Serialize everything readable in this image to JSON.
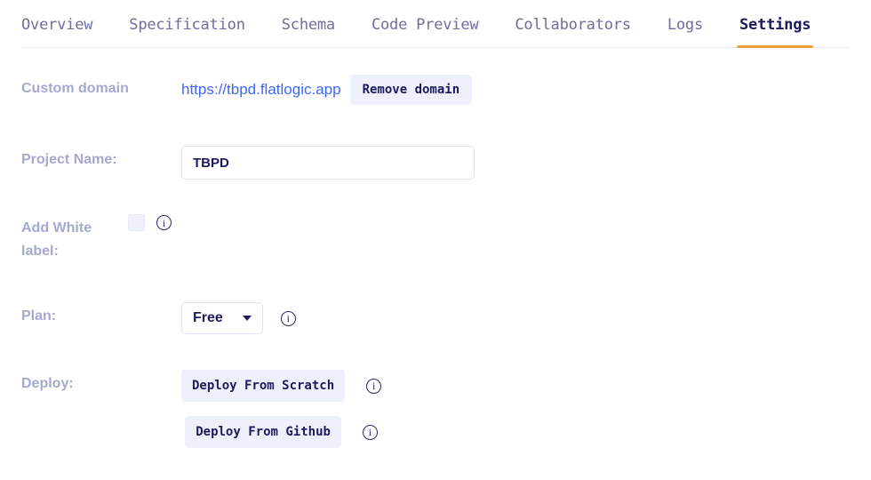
{
  "tabs": [
    {
      "label": "Overview",
      "active": false
    },
    {
      "label": "Specification",
      "active": false
    },
    {
      "label": "Schema",
      "active": false
    },
    {
      "label": "Code Preview",
      "active": false
    },
    {
      "label": "Collaborators",
      "active": false
    },
    {
      "label": "Logs",
      "active": false
    },
    {
      "label": "Settings",
      "active": true
    }
  ],
  "settings": {
    "custom_domain": {
      "label": "Custom domain",
      "url": "https://tbpd.flatlogic.app",
      "remove_button": "Remove domain"
    },
    "project_name": {
      "label": "Project Name:",
      "value": "TBPD",
      "placeholder": "Project Name"
    },
    "white_label": {
      "label": "Add White label:",
      "checked": false,
      "info": "i"
    },
    "plan": {
      "label": "Plan:",
      "selected": "Free",
      "info": "i"
    },
    "deploy": {
      "label": "Deploy:",
      "scratch_button": "Deploy From Scratch",
      "scratch_info": "i",
      "github_button": "Deploy From Github",
      "github_info": "i"
    }
  },
  "colors": {
    "accent_underline": "#f6a03c",
    "link": "#3f68f5",
    "label": "#a5a9d0",
    "text_dark": "#1b1b5e",
    "soft_bg": "#eef1fc"
  }
}
